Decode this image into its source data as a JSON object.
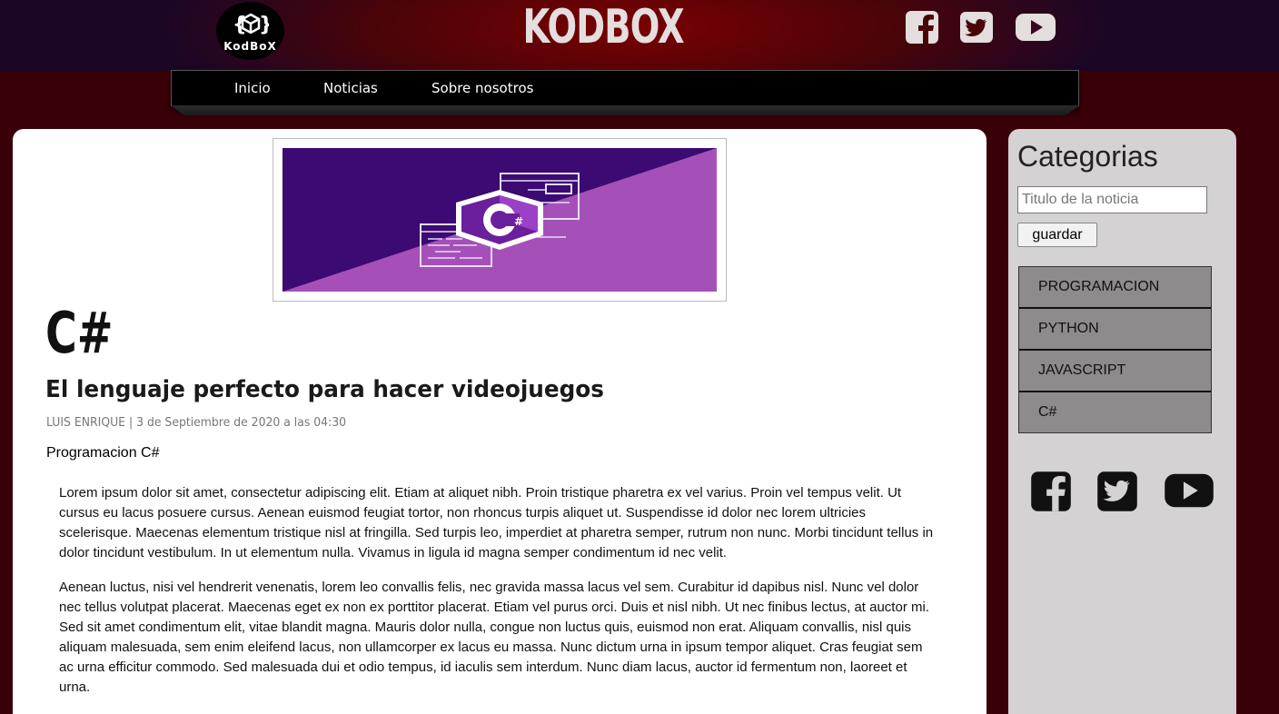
{
  "header": {
    "logo_text": "KodBoX",
    "brand": "KODBOX"
  },
  "nav": {
    "items": [
      {
        "label": "Inicio"
      },
      {
        "label": "Noticias"
      },
      {
        "label": "Sobre nosotros"
      }
    ]
  },
  "article": {
    "title": "C#",
    "subtitle": "El lenguaje perfecto para hacer videojuegos",
    "meta": "LUIS ENRIQUE | 3 de Septiembre de 2020 a las 04:30",
    "category": "Programacion C#",
    "paragraphs": [
      "Lorem ipsum dolor sit amet, consectetur adipiscing elit. Etiam at aliquet nibh. Proin tristique pharetra ex vel varius. Proin vel tempus velit. Ut cursus eu lacus posuere cursus. Aenean euismod feugiat tortor, non rhoncus turpis aliquet ut. Suspendisse id dolor nec lorem ultricies scelerisque. Maecenas elementum tristique nisl at fringilla. Sed turpis leo, imperdiet at pharetra semper, rutrum non nunc. Morbi tincidunt tellus in dolor tincidunt vestibulum. In ut elementum nulla. Vivamus in ligula id magna semper condimentum id nec velit.",
      "Aenean luctus, nisi vel hendrerit venenatis, lorem leo convallis felis, nec gravida massa lacus vel sem. Curabitur id dapibus nisl. Nunc vel dolor nec tellus volutpat placerat. Maecenas eget ex non ex porttitor placerat. Etiam vel purus orci. Duis et nisl nibh. Ut nec finibus lectus, at auctor mi. Sed sit amet condimentum elit, vitae blandit magna. Mauris dolor nulla, congue non luctus quis, euismod non erat. Aliquam convallis, nisl quis aliquam malesuada, sem enim eleifend lacus, non ullamcorper ex lacus eu massa. Nunc dictum urna in ipsum tempor aliquet. Cras feugiat sem ac urna efficitur commodo. Sed malesuada dui et odio tempus, id iaculis sem interdum. Nunc diam lacus, auctor id fermentum non, laoreet et urna."
    ],
    "banner_logo_text": "C#"
  },
  "sidebar": {
    "title": "Categorias",
    "search_placeholder": "Titulo de la noticia",
    "save_label": "guardar",
    "categories": [
      {
        "label": "PROGRAMACION"
      },
      {
        "label": "PYTHON"
      },
      {
        "label": "JAVASCRIPT"
      },
      {
        "label": "C#"
      }
    ]
  },
  "social": {
    "icons": [
      "facebook-icon",
      "twitter-icon",
      "youtube-icon"
    ]
  },
  "colors": {
    "header_red": "#7a0003",
    "page_bg": "#3a0008",
    "banner_dark": "#3b0a72",
    "banner_light": "#a550b8",
    "category_bg": "#8d8b8c"
  }
}
